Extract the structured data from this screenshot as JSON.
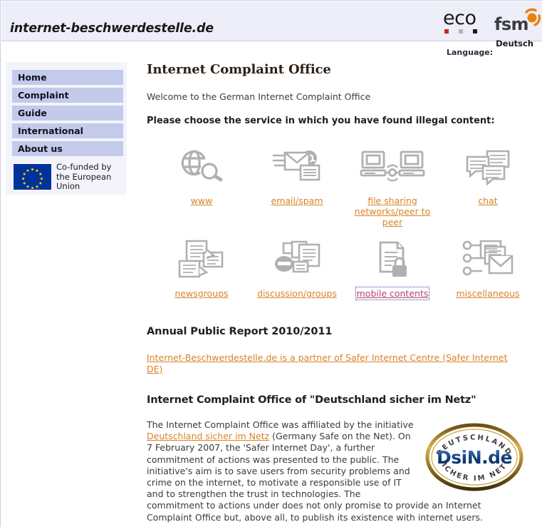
{
  "header": {
    "site_title": "internet-beschwerdestelle.de",
    "eco_logo_text": "eco",
    "eco_dot_colors": [
      "#d81f26",
      "#b3b3b3",
      "#1a1a1a"
    ],
    "fsm_logo_text": "fsm",
    "fsm_accent_color": "#e8820c"
  },
  "language": {
    "label": "Language:",
    "value": "Deutsch"
  },
  "sidebar": {
    "items": [
      {
        "label": "Home"
      },
      {
        "label": "Complaint"
      },
      {
        "label": "Guide"
      },
      {
        "label": "International"
      },
      {
        "label": "About us"
      }
    ],
    "eu_badge": {
      "caption": "Co-funded by the European Union",
      "flag_bg": "#003399",
      "star_color": "#ffcc00"
    }
  },
  "main": {
    "title": "Internet Complaint Office",
    "welcome": "Welcome to the German Internet Complaint Office",
    "choose_prompt": "Please choose the service in which you have found illegal content:"
  },
  "services": {
    "link_color": "#d98326",
    "icon_color": "#b0b0b0",
    "rows": [
      [
        {
          "label": "www",
          "icon": "globe-magnifier-icon",
          "focused": false
        },
        {
          "label": "email/spam",
          "icon": "envelope-at-icon",
          "focused": false
        },
        {
          "label": "file sharing networks/peer to peer",
          "icon": "two-computers-network-icon",
          "focused": false
        },
        {
          "label": "chat",
          "icon": "speech-bubbles-icon",
          "focused": false
        }
      ],
      [
        {
          "label": "newsgroups",
          "icon": "stacked-documents-icon",
          "focused": false
        },
        {
          "label": "discussion/groups",
          "icon": "documents-no-entry-icon",
          "focused": false
        },
        {
          "label": "mobile contents",
          "icon": "document-lock-icon",
          "focused": true
        },
        {
          "label": "miscellaneous",
          "icon": "documents-envelope-nodes-icon",
          "focused": false
        }
      ]
    ]
  },
  "report_section": {
    "heading": "Annual Public Report 2010/2011",
    "partner_link": "Internet-Beschwerdestelle.de is a partner of Safer Internet Centre (Safer Internet DE)"
  },
  "dsin_section": {
    "heading": "Internet Complaint Office of \"Deutschland sicher im Netz\"",
    "body_part1": "The Internet Complaint Office was affiliated by the initiative ",
    "body_link": "Deutschland sicher im Netz",
    "body_part2": " (Germany Safe on the Net). On 7 February 2007, the 'Safer Internet Day', a further commitment of actions was presented to the public. The initiative's aim is to save users from security problems and crime on the internet, to motivate a responsible use of IT and to strengthen the trust in technologies. The commitment to actions under does not only promise to provide an Internet Complaint Office but, above all, to publish its existence with internet users.",
    "logo": {
      "top_arc_text": "DEUTSCHLAND",
      "center_text": "DsiN.de",
      "bottom_arc_text": "SICHER IM NETZ",
      "ring_color": "#c69a2a",
      "center_color": "#1f4fa0"
    }
  }
}
